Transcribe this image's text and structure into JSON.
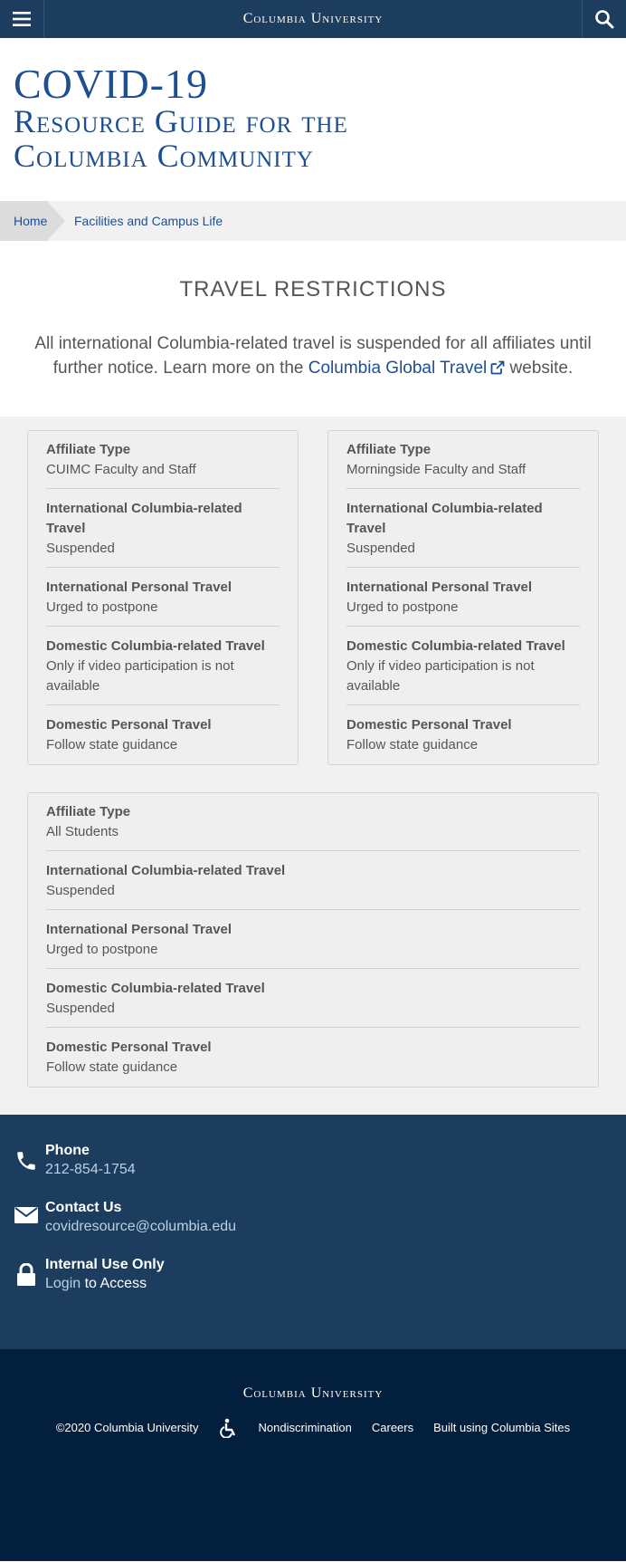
{
  "header": {
    "brand": "Columbia University",
    "menu_icon": "hamburger-menu-icon",
    "search_icon": "search-icon"
  },
  "site_title": {
    "line1": "COVID-19",
    "line2": "Resource Guide for the",
    "line3": "Columbia Community"
  },
  "breadcrumb": {
    "home": "Home",
    "current": "Facilities and Campus Life"
  },
  "intro": {
    "heading": "TRAVEL RESTRICTIONS",
    "text_before": "All international Columbia-related travel is suspended for all affiliates until further notice. Learn more on the ",
    "link_text": "Columbia Global Travel",
    "text_after": " website."
  },
  "cards": [
    {
      "fields": [
        {
          "label": "Affiliate Type",
          "value": "CUIMC Faculty and Staff"
        },
        {
          "label": "International Columbia-related Travel",
          "value": "Suspended"
        },
        {
          "label": "International Personal Travel",
          "value": "Urged to postpone"
        },
        {
          "label": "Domestic Columbia-related Travel",
          "value": "Only if video participation is not available"
        },
        {
          "label": "Domestic Personal Travel",
          "value": "Follow state guidance"
        }
      ]
    },
    {
      "fields": [
        {
          "label": "Affiliate Type",
          "value": "Morningside Faculty and Staff"
        },
        {
          "label": "International Columbia-related Travel",
          "value": "Suspended"
        },
        {
          "label": "International Personal Travel",
          "value": "Urged to postpone"
        },
        {
          "label": "Domestic Columbia-related Travel",
          "value": "Only if video participation is not available"
        },
        {
          "label": "Domestic Personal Travel",
          "value": "Follow state guidance"
        }
      ]
    },
    {
      "fields": [
        {
          "label": "Affiliate Type",
          "value": "All Students"
        },
        {
          "label": "International Columbia-related Travel",
          "value": "Suspended"
        },
        {
          "label": "International Personal Travel",
          "value": "Urged to postpone"
        },
        {
          "label": "Domestic Columbia-related Travel",
          "value": "Suspended"
        },
        {
          "label": "Domestic Personal Travel",
          "value": "Follow state guidance"
        }
      ]
    }
  ],
  "contact": {
    "phone_title": "Phone",
    "phone_value": "212-854-1754",
    "contact_title": "Contact Us",
    "contact_value": "covidresource@columbia.edu",
    "internal_title": "Internal Use Only",
    "login_link": "Login",
    "login_suffix": " to Access"
  },
  "footer": {
    "brand": "Columbia University",
    "copyright": "©2020 Columbia University",
    "accessibility_icon": "accessibility-icon",
    "nondiscrimination": "Nondiscrimination",
    "careers": "Careers",
    "built_using": "Built using Columbia Sites"
  },
  "colors": {
    "navy": "#1d3d5e",
    "dark_navy": "#031f3e",
    "link_blue": "#1d4f91"
  }
}
